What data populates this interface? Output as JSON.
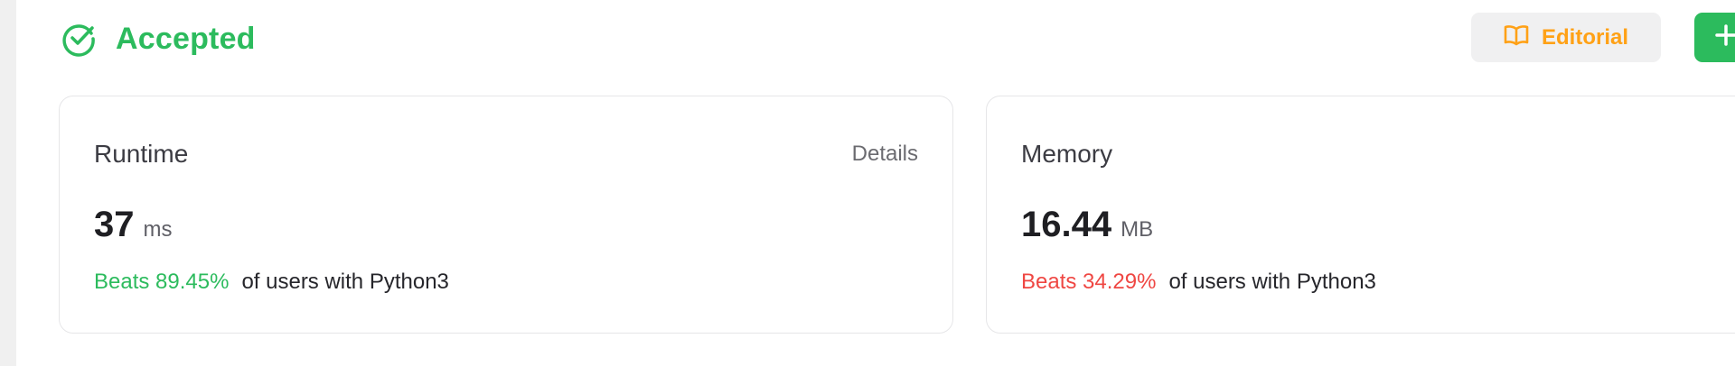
{
  "colors": {
    "accepted": "#2cbb5d",
    "editorial": "#ffa116",
    "add_button": "#2cbb5d",
    "beats_good": "#2cbb5d",
    "beats_bad": "#ef4743"
  },
  "status": {
    "icon": "check-circle-icon",
    "text": "Accepted"
  },
  "toolbar": {
    "editorial_icon": "book-open-icon",
    "editorial_label": "Editorial",
    "add_icon": "plus-icon"
  },
  "runtime": {
    "title": "Runtime",
    "details_label": "Details",
    "value": "37",
    "unit": "ms",
    "beats": "Beats 89.45%",
    "suffix": "of users with Python3"
  },
  "memory": {
    "title": "Memory",
    "value": "16.44",
    "unit": "MB",
    "beats": "Beats 34.29%",
    "suffix": "of users with Python3"
  }
}
